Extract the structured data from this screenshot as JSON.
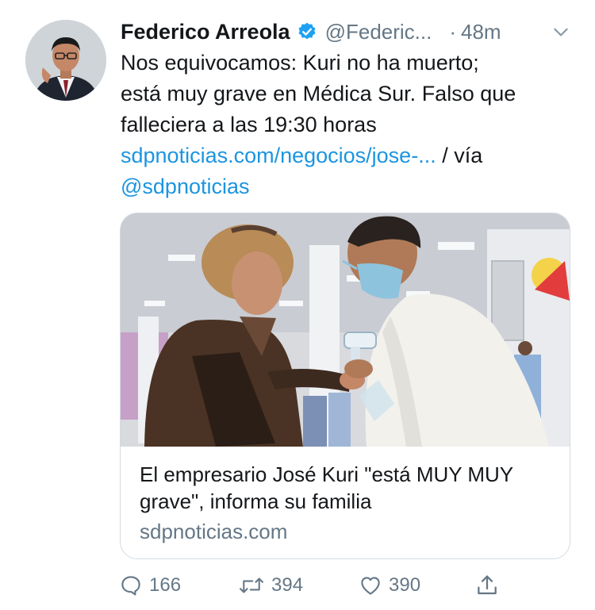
{
  "tweet": {
    "author_name": "Federico Arreola",
    "handle": "@Federic...",
    "separator": "·",
    "time": "48m",
    "text_line1": "Nos equivocamos: Kuri no ha muerto;",
    "text_line2": "está muy grave en Médica Sur. Falso que",
    "text_line3": "falleciera a las 19:30 horas",
    "link_url": "sdpnoticias.com/negocios/jose-...",
    "via_text": " / vía",
    "via_handle": "@sdpnoticias"
  },
  "card": {
    "title": "El empresario José Kuri \"está MUY MUY grave\", informa su familia",
    "domain": "sdpnoticias.com"
  },
  "actions": {
    "replies": "166",
    "retweets": "394",
    "likes": "390"
  },
  "icons": {
    "verified": "verified-badge-icon",
    "caret": "chevron-down-icon",
    "reply": "reply-icon",
    "retweet": "retweet-icon",
    "like": "heart-icon",
    "share": "share-icon"
  },
  "colors": {
    "link": "#1b95e0",
    "verified": "#1da1f2",
    "muted": "#657786",
    "text": "#14171a"
  }
}
